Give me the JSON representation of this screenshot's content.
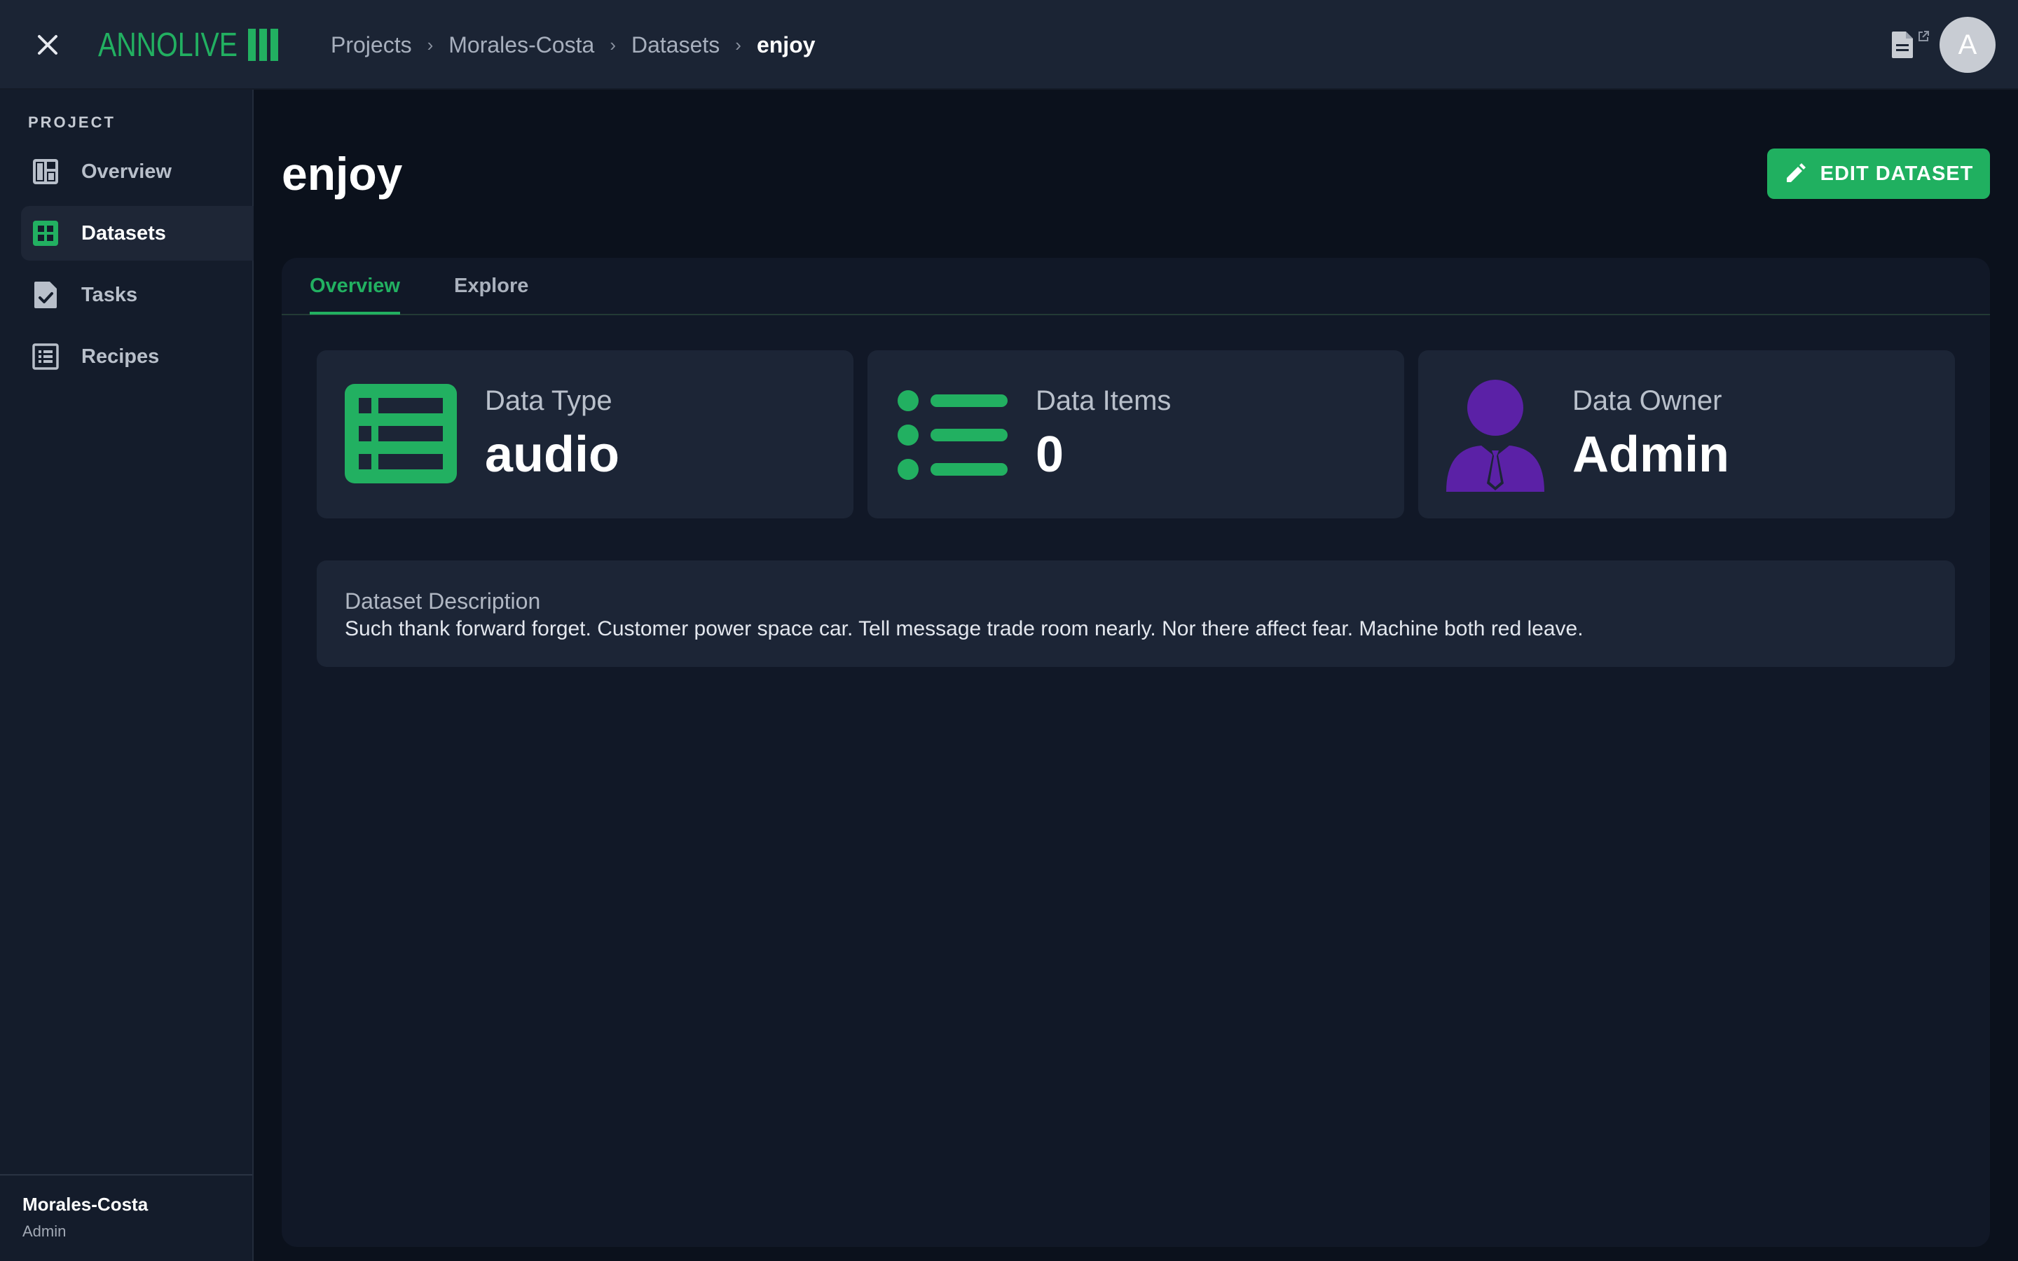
{
  "app": {
    "logo_text": "ANNOLIVE",
    "brand_color": "#22b061"
  },
  "breadcrumb": {
    "items": [
      "Projects",
      "Morales-Costa",
      "Datasets"
    ],
    "current": "enjoy",
    "separator": "›"
  },
  "user": {
    "avatar_initial": "A"
  },
  "sidebar": {
    "heading": "PROJECT",
    "items": [
      {
        "label": "Overview",
        "icon": "dashboard-icon"
      },
      {
        "label": "Datasets",
        "icon": "grid-icon",
        "active": true
      },
      {
        "label": "Tasks",
        "icon": "task-check-icon"
      },
      {
        "label": "Recipes",
        "icon": "list-icon"
      }
    ],
    "footer": {
      "project_name": "Morales-Costa",
      "role": "Admin"
    }
  },
  "main": {
    "title": "enjoy",
    "edit_button_label": "EDIT DATASET",
    "tabs": [
      {
        "label": "Overview",
        "active": true
      },
      {
        "label": "Explore",
        "active": false
      }
    ],
    "cards": [
      {
        "label": "Data Type",
        "value": "audio",
        "icon": "table-icon",
        "icon_color": "#22b061"
      },
      {
        "label": "Data Items",
        "value": "0",
        "icon": "bullet-list-icon",
        "icon_color": "#22b061"
      },
      {
        "label": "Data Owner",
        "value": "Admin",
        "icon": "person-tie-icon",
        "icon_color": "#5b21a6"
      }
    ],
    "description": {
      "label": "Dataset Description",
      "text": "Such thank forward forget. Customer power space car. Tell message trade room nearly. Nor there affect fear. Machine both red leave."
    }
  }
}
